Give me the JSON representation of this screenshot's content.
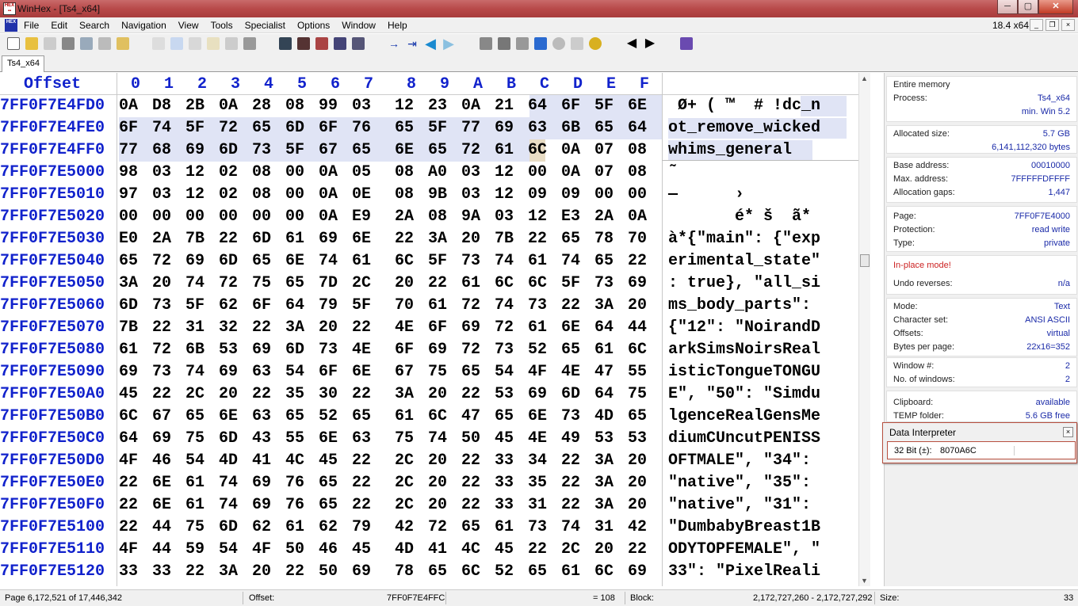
{
  "window": {
    "title": "WinHex - [Ts4_x64]",
    "min_glyph": "─",
    "max_glyph": "▢",
    "close_glyph": "✕"
  },
  "menu": {
    "items": [
      "File",
      "Edit",
      "Search",
      "Navigation",
      "View",
      "Tools",
      "Specialist",
      "Options",
      "Window",
      "Help"
    ],
    "zoom": "18.4 x64",
    "mdi": [
      "_",
      "❐",
      "×"
    ]
  },
  "tab": {
    "label": "Ts4_x64"
  },
  "hex": {
    "offset_header": "Offset",
    "columns": [
      "0",
      "1",
      "2",
      "3",
      "4",
      "5",
      "6",
      "7",
      "8",
      "9",
      "A",
      "B",
      "C",
      "D",
      "E",
      "F"
    ],
    "rows": [
      {
        "addr": "7FF0F7E4FD0",
        "bytes": [
          "0A",
          "D8",
          "2B",
          "0A",
          "28",
          "08",
          "99",
          "03",
          "12",
          "23",
          "0A",
          "21",
          "64",
          "6F",
          "5F",
          "6E"
        ],
        "text": " Ø+ ( ™  # !dc_n"
      },
      {
        "addr": "7FF0F7E4FE0",
        "bytes": [
          "6F",
          "74",
          "5F",
          "72",
          "65",
          "6D",
          "6F",
          "76",
          "65",
          "5F",
          "77",
          "69",
          "63",
          "6B",
          "65",
          "64"
        ],
        "text": "ot_remove_wicked"
      },
      {
        "addr": "7FF0F7E4FF0",
        "bytes": [
          "77",
          "68",
          "69",
          "6D",
          "73",
          "5F",
          "67",
          "65",
          "6E",
          "65",
          "72",
          "61",
          "6C",
          "0A",
          "07",
          "08"
        ],
        "text": "whims_general"
      },
      {
        "addr": "7FF0F7E5000",
        "bytes": [
          "98",
          "03",
          "12",
          "02",
          "08",
          "00",
          "0A",
          "05",
          "08",
          "A0",
          "03",
          "12",
          "00",
          "0A",
          "07",
          "08"
        ],
        "text": "˜"
      },
      {
        "addr": "7FF0F7E5010",
        "bytes": [
          "97",
          "03",
          "12",
          "02",
          "08",
          "00",
          "0A",
          "0E",
          "08",
          "9B",
          "03",
          "12",
          "09",
          "09",
          "00",
          "00"
        ],
        "text": "—      ›"
      },
      {
        "addr": "7FF0F7E5020",
        "bytes": [
          "00",
          "00",
          "00",
          "00",
          "00",
          "00",
          "0A",
          "E9",
          "2A",
          "08",
          "9A",
          "03",
          "12",
          "E3",
          "2A",
          "0A"
        ],
        "text": "       é* š  ã*"
      },
      {
        "addr": "7FF0F7E5030",
        "bytes": [
          "E0",
          "2A",
          "7B",
          "22",
          "6D",
          "61",
          "69",
          "6E",
          "22",
          "3A",
          "20",
          "7B",
          "22",
          "65",
          "78",
          "70"
        ],
        "text": "à*{\"main\": {\"exp"
      },
      {
        "addr": "7FF0F7E5040",
        "bytes": [
          "65",
          "72",
          "69",
          "6D",
          "65",
          "6E",
          "74",
          "61",
          "6C",
          "5F",
          "73",
          "74",
          "61",
          "74",
          "65",
          "22"
        ],
        "text": "erimental_state\""
      },
      {
        "addr": "7FF0F7E5050",
        "bytes": [
          "3A",
          "20",
          "74",
          "72",
          "75",
          "65",
          "7D",
          "2C",
          "20",
          "22",
          "61",
          "6C",
          "6C",
          "5F",
          "73",
          "69"
        ],
        "text": ": true}, \"all_si"
      },
      {
        "addr": "7FF0F7E5060",
        "bytes": [
          "6D",
          "73",
          "5F",
          "62",
          "6F",
          "64",
          "79",
          "5F",
          "70",
          "61",
          "72",
          "74",
          "73",
          "22",
          "3A",
          "20"
        ],
        "text": "ms_body_parts\": "
      },
      {
        "addr": "7FF0F7E5070",
        "bytes": [
          "7B",
          "22",
          "31",
          "32",
          "22",
          "3A",
          "20",
          "22",
          "4E",
          "6F",
          "69",
          "72",
          "61",
          "6E",
          "64",
          "44"
        ],
        "text": "{\"12\": \"NoirandD"
      },
      {
        "addr": "7FF0F7E5080",
        "bytes": [
          "61",
          "72",
          "6B",
          "53",
          "69",
          "6D",
          "73",
          "4E",
          "6F",
          "69",
          "72",
          "73",
          "52",
          "65",
          "61",
          "6C"
        ],
        "text": "arkSimsNoirsReal"
      },
      {
        "addr": "7FF0F7E5090",
        "bytes": [
          "69",
          "73",
          "74",
          "69",
          "63",
          "54",
          "6F",
          "6E",
          "67",
          "75",
          "65",
          "54",
          "4F",
          "4E",
          "47",
          "55"
        ],
        "text": "isticTongueTONGU"
      },
      {
        "addr": "7FF0F7E50A0",
        "bytes": [
          "45",
          "22",
          "2C",
          "20",
          "22",
          "35",
          "30",
          "22",
          "3A",
          "20",
          "22",
          "53",
          "69",
          "6D",
          "64",
          "75"
        ],
        "text": "E\", \"50\": \"Simdu"
      },
      {
        "addr": "7FF0F7E50B0",
        "bytes": [
          "6C",
          "67",
          "65",
          "6E",
          "63",
          "65",
          "52",
          "65",
          "61",
          "6C",
          "47",
          "65",
          "6E",
          "73",
          "4D",
          "65"
        ],
        "text": "lgenceRealGensMe"
      },
      {
        "addr": "7FF0F7E50C0",
        "bytes": [
          "64",
          "69",
          "75",
          "6D",
          "43",
          "55",
          "6E",
          "63",
          "75",
          "74",
          "50",
          "45",
          "4E",
          "49",
          "53",
          "53"
        ],
        "text": "diumCUncutPENISS"
      },
      {
        "addr": "7FF0F7E50D0",
        "bytes": [
          "4F",
          "46",
          "54",
          "4D",
          "41",
          "4C",
          "45",
          "22",
          "2C",
          "20",
          "22",
          "33",
          "34",
          "22",
          "3A",
          "20"
        ],
        "text": "OFTMALE\", \"34\": "
      },
      {
        "addr": "7FF0F7E50E0",
        "bytes": [
          "22",
          "6E",
          "61",
          "74",
          "69",
          "76",
          "65",
          "22",
          "2C",
          "20",
          "22",
          "33",
          "35",
          "22",
          "3A",
          "20"
        ],
        "text": "\"native\", \"35\": "
      },
      {
        "addr": "7FF0F7E50F0",
        "bytes": [
          "22",
          "6E",
          "61",
          "74",
          "69",
          "76",
          "65",
          "22",
          "2C",
          "20",
          "22",
          "33",
          "31",
          "22",
          "3A",
          "20"
        ],
        "text": "\"native\", \"31\": "
      },
      {
        "addr": "7FF0F7E5100",
        "bytes": [
          "22",
          "44",
          "75",
          "6D",
          "62",
          "61",
          "62",
          "79",
          "42",
          "72",
          "65",
          "61",
          "73",
          "74",
          "31",
          "42"
        ],
        "text": "\"DumbabyBreast1B"
      },
      {
        "addr": "7FF0F7E5110",
        "bytes": [
          "4F",
          "44",
          "59",
          "54",
          "4F",
          "50",
          "46",
          "45",
          "4D",
          "41",
          "4C",
          "45",
          "22",
          "2C",
          "20",
          "22"
        ],
        "text": "ODYTOPFEMALE\", \""
      },
      {
        "addr": "7FF0F7E5120",
        "bytes": [
          "33",
          "33",
          "22",
          "3A",
          "20",
          "22",
          "50",
          "69",
          "78",
          "65",
          "6C",
          "52",
          "65",
          "61",
          "6C",
          "69"
        ],
        "text": "33\": \"PixelReali"
      }
    ]
  },
  "info": {
    "entire_memory": "Entire memory",
    "process_label": "Process:",
    "process_value": "Ts4_x64",
    "process_os": "min. Win 5.2",
    "allocated_label": "Allocated size:",
    "allocated_value": "5.7 GB",
    "allocated_bytes": "6,141,112,320 bytes",
    "base_label": "Base address:",
    "base_value": "00010000",
    "max_label": "Max. address:",
    "max_value": "7FFFFFDFFFF",
    "gaps_label": "Allocation gaps:",
    "gaps_value": "1,447",
    "page_label": "Page:",
    "page_value": "7FF0F7E4000",
    "prot_label": "Protection:",
    "prot_value": "read write",
    "type_label": "Type:",
    "type_value": "private",
    "inplace": "In-place mode!",
    "undo_label": "Undo reverses:",
    "undo_value": "n/a",
    "mode_label": "Mode:",
    "mode_value": "Text",
    "charset_label": "Character set:",
    "charset_value": "ANSI ASCII",
    "offsets_label": "Offsets:",
    "offsets_value": "virtual",
    "bpp_label": "Bytes per page:",
    "bpp_value": "22x16=352",
    "win_label": "Window #:",
    "win_value": "2",
    "nwin_label": "No. of windows:",
    "nwin_value": "2",
    "clip_label": "Clipboard:",
    "clip_value": "available",
    "temp_label": "TEMP folder:",
    "temp_value": "5.6 GB free"
  },
  "interpreter": {
    "title": "Data Interpreter",
    "label": "32 Bit (±):",
    "value": "8070A6C",
    "close": "×"
  },
  "status": {
    "page": "Page 6,172,521 of 17,446,342",
    "offset_label": "Offset:",
    "offset_value": "7FF0F7E4FFC",
    "eq": "= 108",
    "block_label": "Block:",
    "block_value": "2,172,727,260 - 2,172,727,292",
    "size_label": "Size:",
    "size_value": "33"
  },
  "colors": {
    "accent_blue": "#1122cc",
    "selection": "#e0e4f5",
    "title_red": "#b84a4a",
    "inplace_red": "#cc2222"
  }
}
